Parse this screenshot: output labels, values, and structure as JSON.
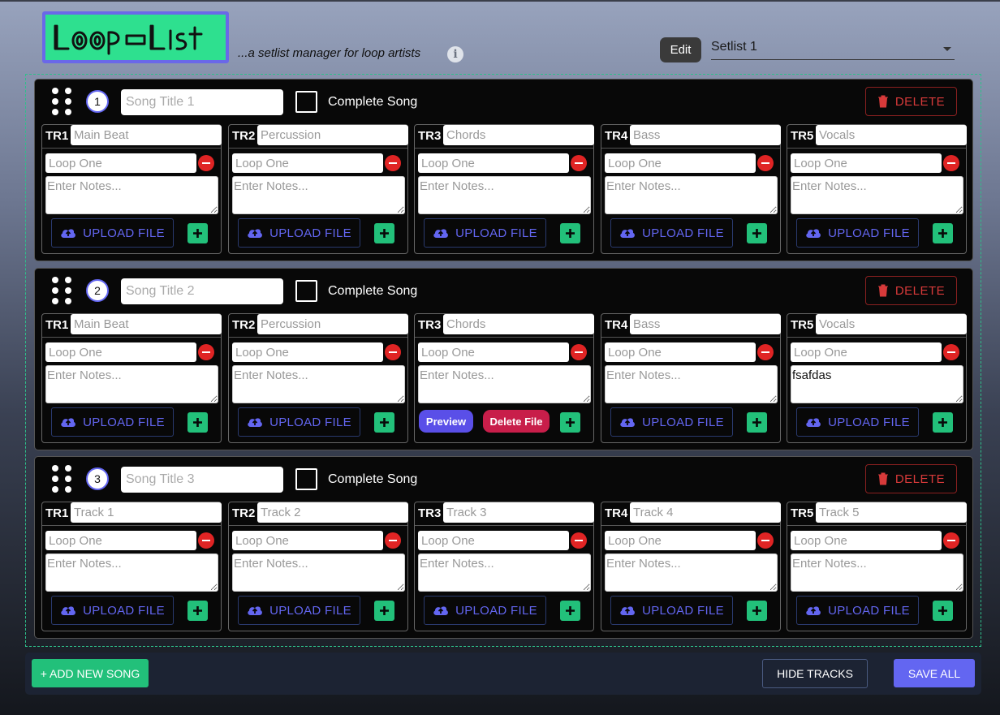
{
  "header": {
    "logo_text": "Loop-List",
    "tagline": "...a setlist manager for loop artists",
    "info_icon": "i",
    "edit_label": "Edit",
    "setlist_selected": "Setlist 1"
  },
  "labels": {
    "complete_song": "Complete Song",
    "delete": "DELETE",
    "upload_file": "UPLOAD FILE",
    "preview": "Preview",
    "delete_file": "Delete File",
    "loop_placeholder": "Loop One",
    "notes_placeholder": "Enter Notes..."
  },
  "songs": [
    {
      "number": "1",
      "title_placeholder": "Song Title 1",
      "tracks": [
        {
          "label": "TR1",
          "name_placeholder": "Main Beat",
          "notes": ""
        },
        {
          "label": "TR2",
          "name_placeholder": "Percussion",
          "notes": ""
        },
        {
          "label": "TR3",
          "name_placeholder": "Chords",
          "notes": ""
        },
        {
          "label": "TR4",
          "name_placeholder": "Bass",
          "notes": ""
        },
        {
          "label": "TR5",
          "name_placeholder": "Vocals",
          "notes": ""
        }
      ]
    },
    {
      "number": "2",
      "title_placeholder": "Song Title 2",
      "tracks": [
        {
          "label": "TR1",
          "name_placeholder": "Main Beat",
          "notes": ""
        },
        {
          "label": "TR2",
          "name_placeholder": "Percussion",
          "notes": ""
        },
        {
          "label": "TR3",
          "name_placeholder": "Chords",
          "notes": "",
          "has_file": true
        },
        {
          "label": "TR4",
          "name_placeholder": "Bass",
          "notes": ""
        },
        {
          "label": "TR5",
          "name_placeholder": "Vocals",
          "notes": "fsafdas"
        }
      ]
    },
    {
      "number": "3",
      "title_placeholder": "Song Title 3",
      "tracks": [
        {
          "label": "TR1",
          "name_placeholder": "Track 1",
          "notes": ""
        },
        {
          "label": "TR2",
          "name_placeholder": "Track 2",
          "notes": ""
        },
        {
          "label": "TR3",
          "name_placeholder": "Track 3",
          "notes": ""
        },
        {
          "label": "TR4",
          "name_placeholder": "Track 4",
          "notes": ""
        },
        {
          "label": "TR5",
          "name_placeholder": "Track 5",
          "notes": ""
        }
      ]
    }
  ],
  "footer": {
    "add_song": "+ ADD NEW SONG",
    "hide_tracks": "HIDE TRACKS",
    "save_all": "SAVE ALL"
  },
  "colors": {
    "accent": "#6366f1",
    "success": "#22c07a",
    "danger": "#e02424",
    "logo_bg": "#2ee08f"
  },
  "icons": {
    "drag": "drag-handle-icon",
    "trash": "trash-icon",
    "upload": "cloud-upload-icon",
    "plus": "plus-icon",
    "minus": "minus-circle-icon",
    "dropdown": "chevron-down-icon"
  }
}
